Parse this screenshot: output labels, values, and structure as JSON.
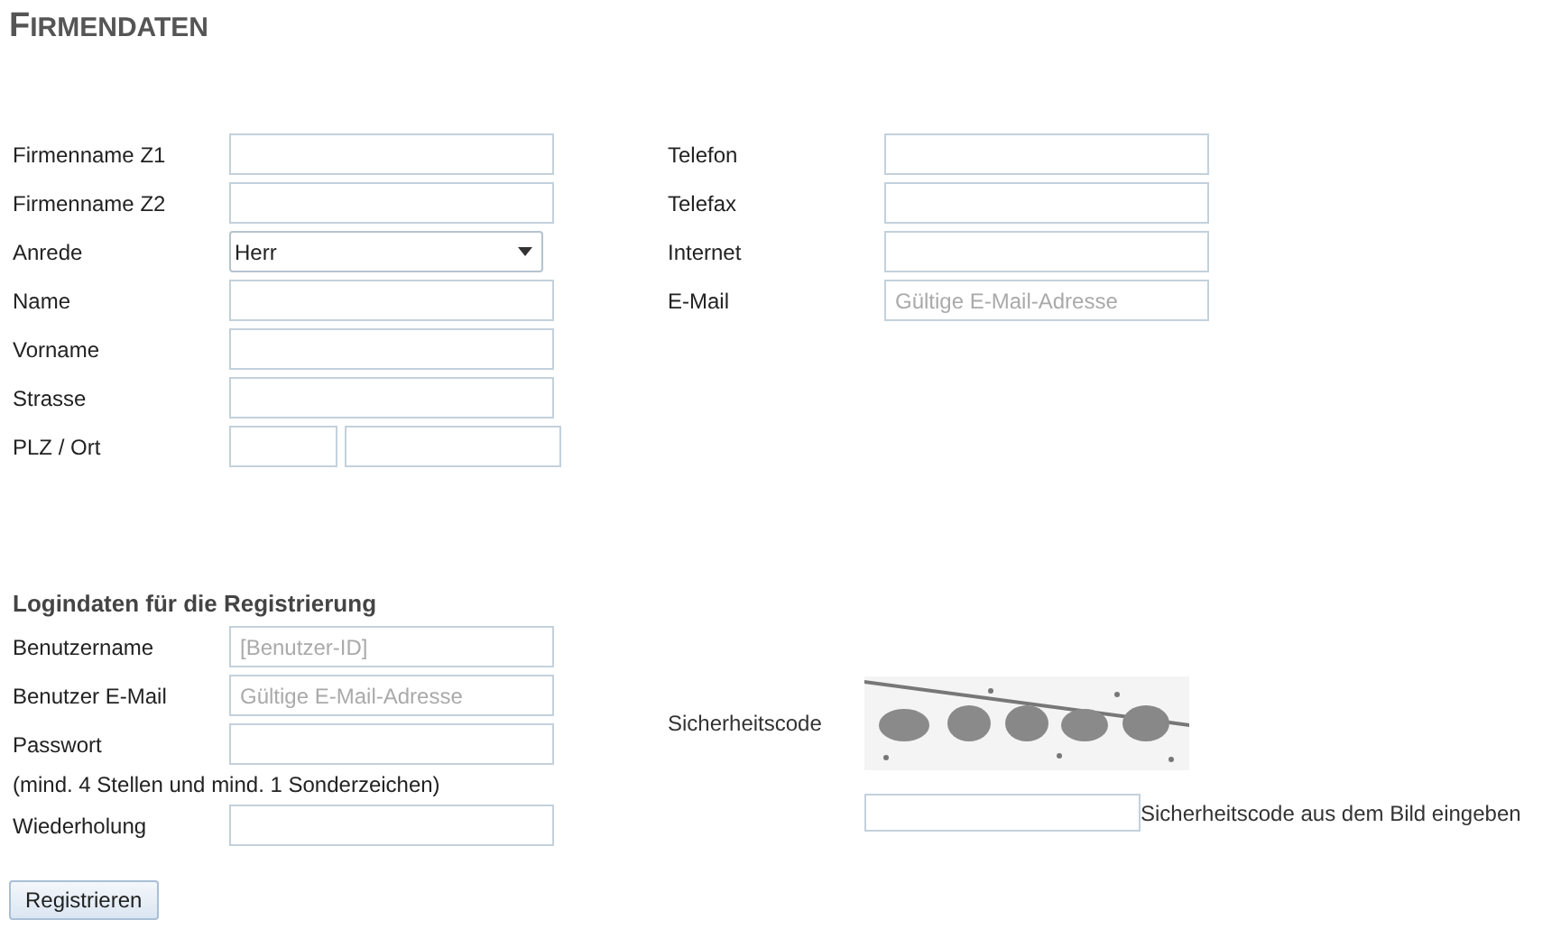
{
  "title": "FIRMENDATEN",
  "company_left": [
    {
      "label": "Firmenname Z1",
      "kind": "text"
    },
    {
      "label": "Firmenname Z2",
      "kind": "text"
    },
    {
      "label": "Anrede",
      "kind": "select",
      "value": "Herr"
    },
    {
      "label": "Name",
      "kind": "text"
    },
    {
      "label": "Vorname",
      "kind": "text"
    },
    {
      "label": "Strasse",
      "kind": "text"
    },
    {
      "label": "PLZ / Ort",
      "kind": "split"
    }
  ],
  "company_right": [
    {
      "label": "Telefon",
      "kind": "text"
    },
    {
      "label": "Telefax",
      "kind": "text"
    },
    {
      "label": "Internet",
      "kind": "text"
    },
    {
      "label": "E-Mail",
      "kind": "text",
      "placeholder": "Gültige E-Mail-Adresse"
    }
  ],
  "login": {
    "heading": "Logindaten für die Registrierung",
    "fields": [
      {
        "label": "Benutzername",
        "kind": "text",
        "placeholder": "[Benutzer-ID]"
      },
      {
        "label": "Benutzer E-Mail",
        "kind": "text",
        "placeholder": "Gültige E-Mail-Adresse"
      },
      {
        "label": "Passwort",
        "kind": "password"
      },
      {
        "label": "(mind. 4 Stellen und mind. 1 Sonderzeichen)",
        "kind": "hint"
      },
      {
        "label": "Wiederholung",
        "kind": "password"
      }
    ]
  },
  "captcha": {
    "label": "Sicherheitscode",
    "instruction": "Sicherheitscode aus dem Bild eingeben"
  },
  "submit_button": "Registrieren"
}
